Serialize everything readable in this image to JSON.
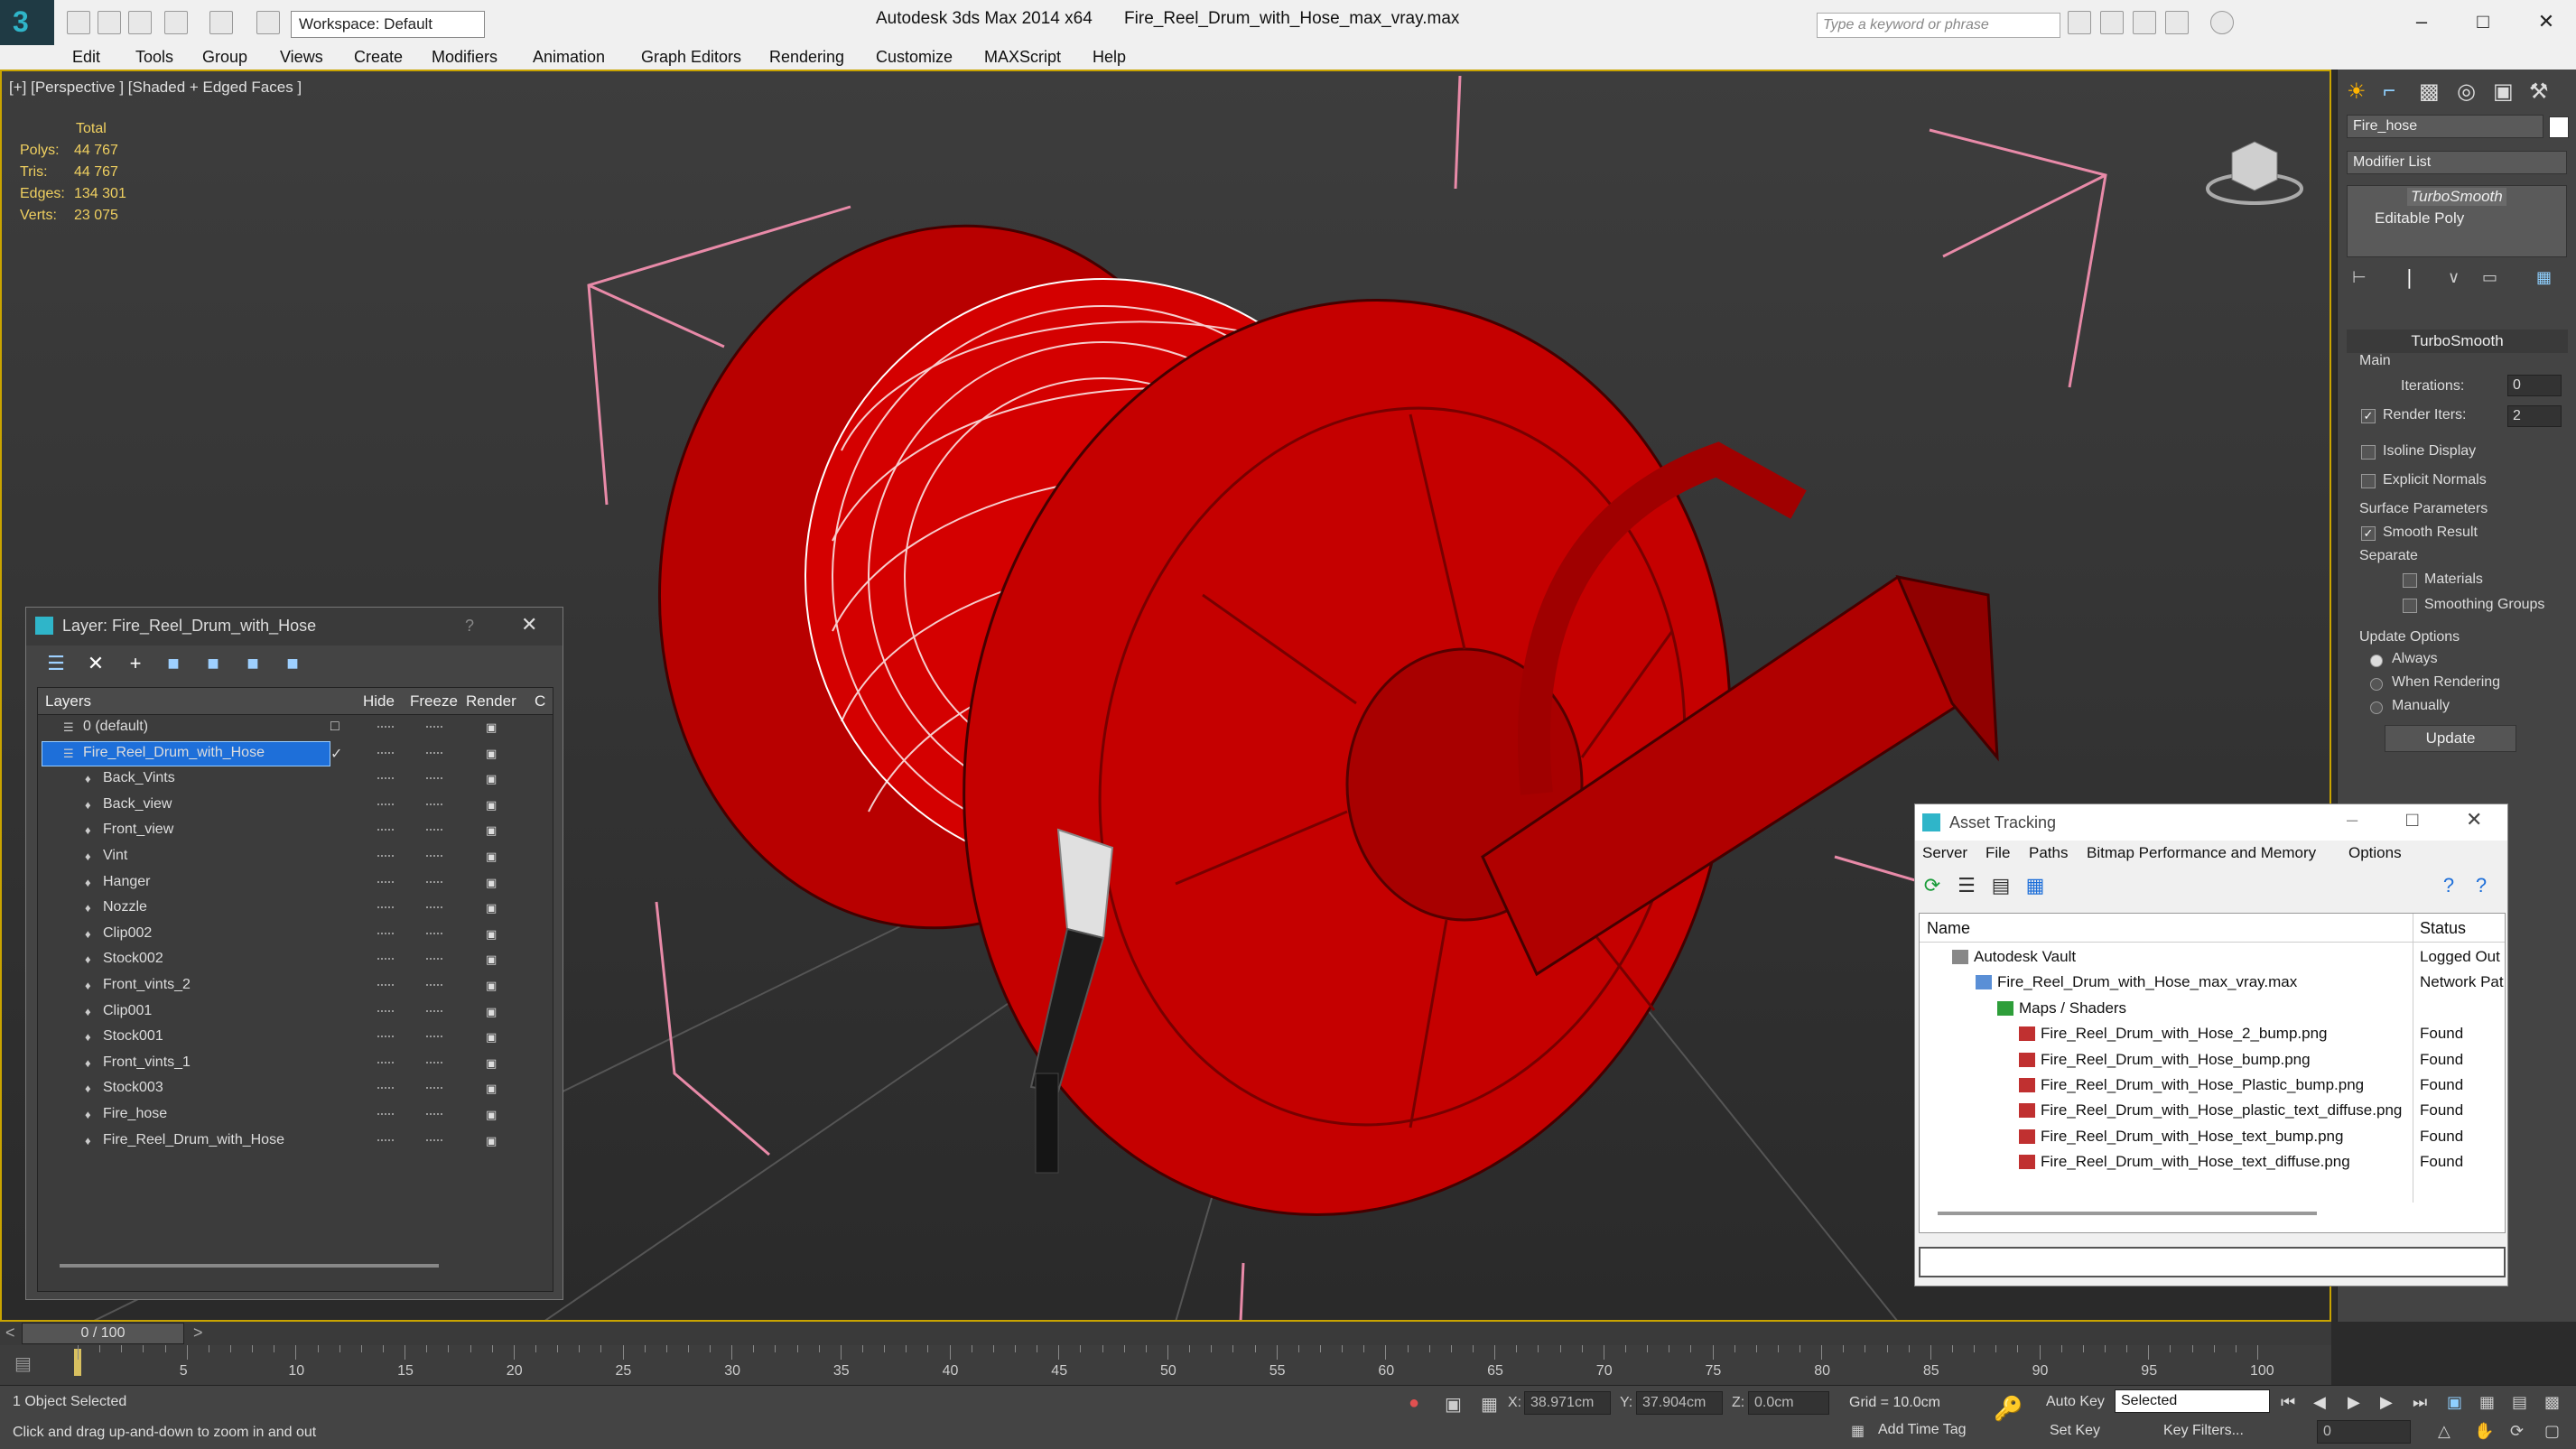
{
  "titlebar": {
    "workspace": "Workspace: Default",
    "app": "Autodesk 3ds Max  2014 x64",
    "file": "Fire_Reel_Drum_with_Hose_max_vray.max",
    "search_placeholder": "Type a keyword or phrase"
  },
  "menu": [
    "Edit",
    "Tools",
    "Group",
    "Views",
    "Create",
    "Modifiers",
    "Animation",
    "Graph Editors",
    "Rendering",
    "Customize",
    "MAXScript",
    "Help"
  ],
  "viewport": {
    "label": "[+] [Perspective ] [Shaded + Edged Faces ]",
    "stats": {
      "header": "Total",
      "rows": [
        {
          "k": "Polys:",
          "v": "44 767"
        },
        {
          "k": "Tris:",
          "v": "44 767"
        },
        {
          "k": "Edges:",
          "v": "134 301"
        },
        {
          "k": "Verts:",
          "v": "23 075"
        }
      ]
    },
    "model_color": "#c00000"
  },
  "layer_window": {
    "title": "Layer: Fire_Reel_Drum_with_Hose",
    "help": "?",
    "columns": [
      "Layers",
      "Hide",
      "Freeze",
      "Render",
      "C"
    ],
    "rows": [
      {
        "name": "0 (default)",
        "level": 0
      },
      {
        "name": "Fire_Reel_Drum_with_Hose",
        "level": 0,
        "selected": true
      },
      {
        "name": "Back_Vints",
        "level": 1
      },
      {
        "name": "Back_view",
        "level": 1
      },
      {
        "name": "Front_view",
        "level": 1
      },
      {
        "name": "Vint",
        "level": 1
      },
      {
        "name": "Hanger",
        "level": 1
      },
      {
        "name": "Nozzle",
        "level": 1
      },
      {
        "name": "Clip002",
        "level": 1
      },
      {
        "name": "Stock002",
        "level": 1
      },
      {
        "name": "Front_vints_2",
        "level": 1
      },
      {
        "name": "Clip001",
        "level": 1
      },
      {
        "name": "Stock001",
        "level": 1
      },
      {
        "name": "Front_vints_1",
        "level": 1
      },
      {
        "name": "Stock003",
        "level": 1
      },
      {
        "name": "Fire_hose",
        "level": 1
      },
      {
        "name": "Fire_Reel_Drum_with_Hose",
        "level": 1
      }
    ]
  },
  "command_panel": {
    "object_name": "Fire_hose",
    "modifier_list": "Modifier List",
    "stack": [
      "TurboSmooth",
      "Editable Poly"
    ],
    "rollout": "TurboSmooth",
    "main_label": "Main",
    "iterations_label": "Iterations:",
    "iterations": "0",
    "render_iters_label": "Render Iters:",
    "render_iters": "2",
    "isoline": "Isoline Display",
    "explicit_normals": "Explicit Normals",
    "surface_params": "Surface Parameters",
    "smooth_result": "Smooth Result",
    "separate": "Separate",
    "materials": "Materials",
    "smoothing_groups": "Smoothing Groups",
    "update_options": "Update Options",
    "always": "Always",
    "when_rendering": "When Rendering",
    "manually": "Manually",
    "update_btn": "Update"
  },
  "asset_window": {
    "title": "Asset Tracking",
    "menu": [
      "Server",
      "File",
      "Paths",
      "Bitmap Performance and Memory",
      "Options"
    ],
    "columns": [
      "Name",
      "Status"
    ],
    "rows": [
      {
        "name": "Autodesk Vault",
        "status": "Logged Out",
        "level": 0
      },
      {
        "name": "Fire_Reel_Drum_with_Hose_max_vray.max",
        "status": "Network Pat",
        "level": 1
      },
      {
        "name": "Maps / Shaders",
        "status": "",
        "level": 2
      },
      {
        "name": "Fire_Reel_Drum_with_Hose_2_bump.png",
        "status": "Found",
        "level": 3
      },
      {
        "name": "Fire_Reel_Drum_with_Hose_bump.png",
        "status": "Found",
        "level": 3
      },
      {
        "name": "Fire_Reel_Drum_with_Hose_Plastic_bump.png",
        "status": "Found",
        "level": 3
      },
      {
        "name": "Fire_Reel_Drum_with_Hose_plastic_text_diffuse.png",
        "status": "Found",
        "level": 3
      },
      {
        "name": "Fire_Reel_Drum_with_Hose_text_bump.png",
        "status": "Found",
        "level": 3
      },
      {
        "name": "Fire_Reel_Drum_with_Hose_text_diffuse.png",
        "status": "Found",
        "level": 3
      }
    ]
  },
  "timeline": {
    "frame": "0 / 100",
    "ticks": [
      "5",
      "10",
      "15",
      "20",
      "25",
      "30",
      "35",
      "40",
      "45",
      "50",
      "55",
      "60",
      "65",
      "70",
      "75",
      "80",
      "85",
      "90",
      "95",
      "100"
    ]
  },
  "statusbar": {
    "selection": "1 Object Selected",
    "prompt": "Click and drag up-and-down to zoom in and out",
    "x_label": "X:",
    "x": "38.971cm",
    "y_label": "Y:",
    "y": "37.904cm",
    "z_label": "Z:",
    "z": "0.0cm",
    "grid": "Grid = 10.0cm",
    "auto_key": "Auto Key",
    "selected": "Selected",
    "set_key": "Set Key",
    "key_filters": "Key Filters...",
    "add_time_tag": "Add Time Tag",
    "frame": "0"
  }
}
